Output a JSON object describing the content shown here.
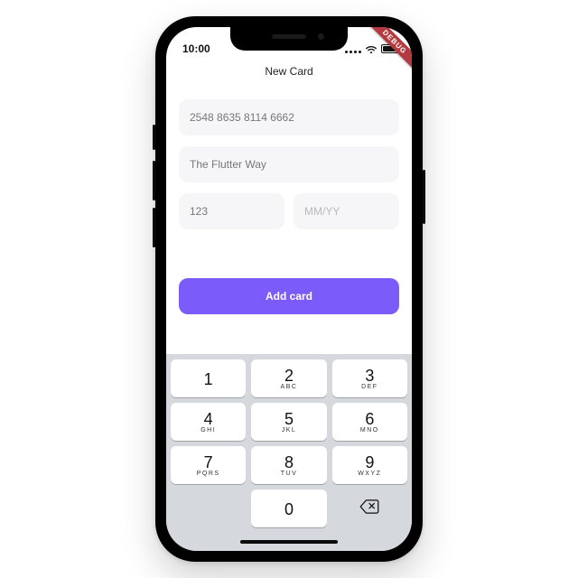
{
  "status": {
    "time": "10:00"
  },
  "ribbon": {
    "label": "DEBUG"
  },
  "header": {
    "title": "New Card"
  },
  "form": {
    "card_number": {
      "value": "2548  8635  8114  6662"
    },
    "card_holder": {
      "value": "The Flutter Way"
    },
    "cvv": {
      "value": "123"
    },
    "expiry": {
      "placeholder": "MM/YY"
    }
  },
  "actions": {
    "add_label": "Add card"
  },
  "keypad": {
    "k1": {
      "d": "1",
      "s": ""
    },
    "k2": {
      "d": "2",
      "s": "ABC"
    },
    "k3": {
      "d": "3",
      "s": "DEF"
    },
    "k4": {
      "d": "4",
      "s": "GHI"
    },
    "k5": {
      "d": "5",
      "s": "JKL"
    },
    "k6": {
      "d": "6",
      "s": "MNO"
    },
    "k7": {
      "d": "7",
      "s": "PQRS"
    },
    "k8": {
      "d": "8",
      "s": "TUV"
    },
    "k9": {
      "d": "9",
      "s": "WXYZ"
    },
    "k0": {
      "d": "0",
      "s": ""
    }
  }
}
